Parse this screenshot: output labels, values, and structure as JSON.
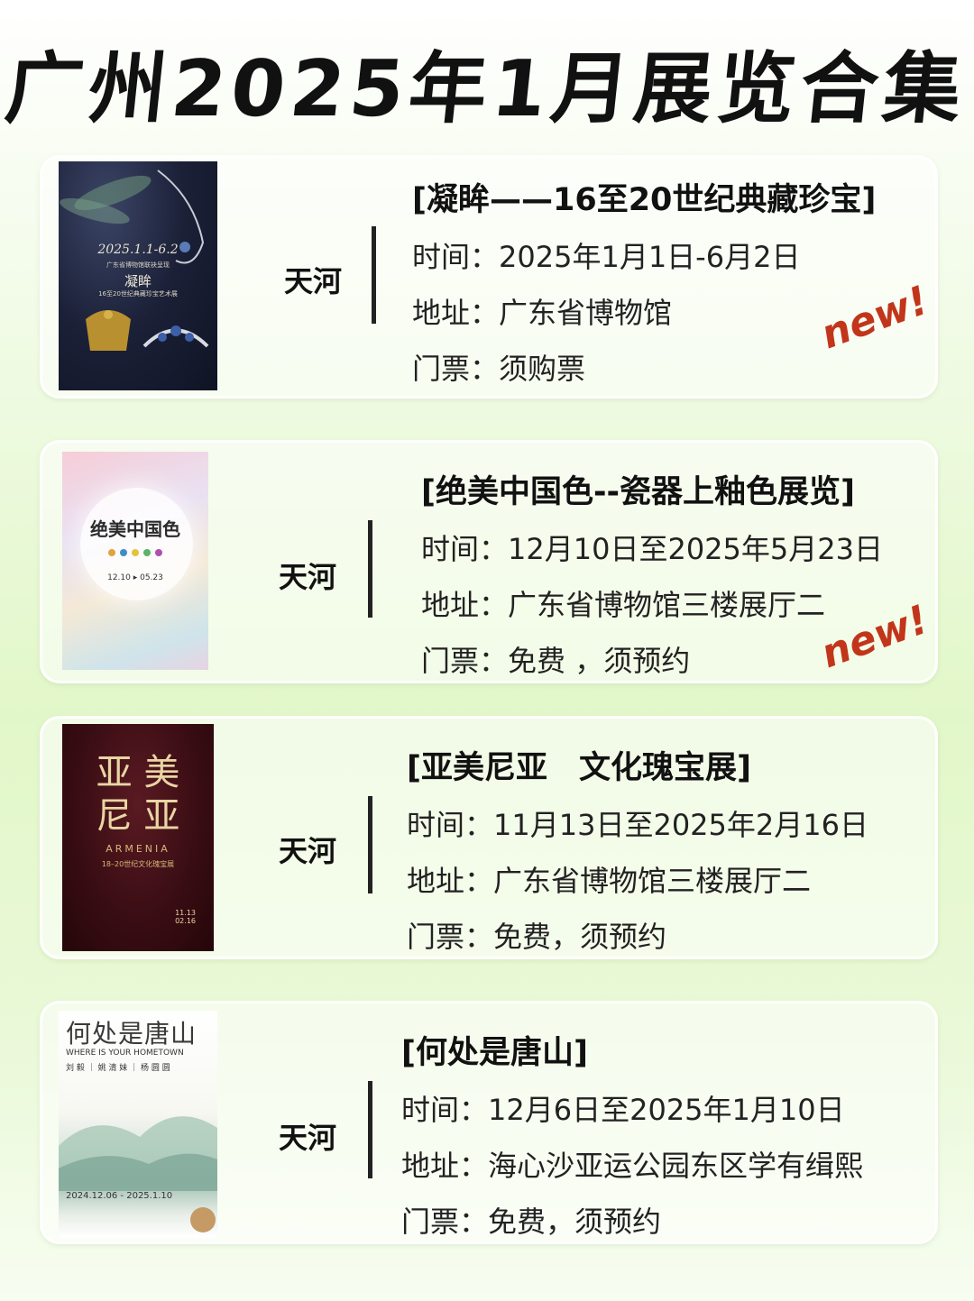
{
  "page_title": "广州2025年1月展览合集",
  "labels": {
    "time": "时间：",
    "address": "地址：",
    "ticket": "门票："
  },
  "new_badge": "new!",
  "exhibitions": [
    {
      "title": "[凝眸——16至20世纪典藏珍宝]",
      "district": "天河",
      "time": "2025年1月1日-6月2日",
      "address": "广东省博物馆",
      "ticket": "须购票",
      "is_new": true,
      "poster": {
        "date": "2025.1.1-6.2",
        "subtitle": "广东省博物馆联袂呈现",
        "name": "凝眸",
        "subtitle2": "16至20世纪典藏珍宝艺术展"
      }
    },
    {
      "title": "[绝美中国色--瓷器上釉色展览]",
      "district": "天河",
      "time": "12月10日至2025年5月23日",
      "address": "广东省博物馆三楼展厅二",
      "ticket": "免费 ，须预约",
      "is_new": true,
      "poster": {
        "name": "绝美中国色",
        "date": "12.10 ▸ 05.23"
      }
    },
    {
      "title": "[亚美尼亚　文化瑰宝展]",
      "district": "天河",
      "time": "11月13日至2025年2月16日",
      "address": "广东省博物馆三楼展厅二",
      "ticket": "免费，须预约",
      "is_new": false,
      "poster": {
        "name_line1": "亚 美",
        "name_line2": "尼 亚",
        "en": "ARMENIA",
        "cn": "18–20世纪文化瑰宝展",
        "date1": "11.13",
        "date2": "02.16"
      }
    },
    {
      "title": "[何处是唐山]",
      "district": "天河",
      "time": "12月6日至2025年1月10日",
      "address": "海心沙亚运公园东区学有缉熙",
      "ticket": "免费，须预约",
      "is_new": false,
      "poster": {
        "name": "何处是唐山",
        "en": "WHERE IS YOUR HOMETOWN",
        "names": "刘 毅 ｜ 姚 清 妹 ｜ 杨 圆 圆",
        "date": "2024.12.06 - 2025.1.10"
      }
    }
  ]
}
